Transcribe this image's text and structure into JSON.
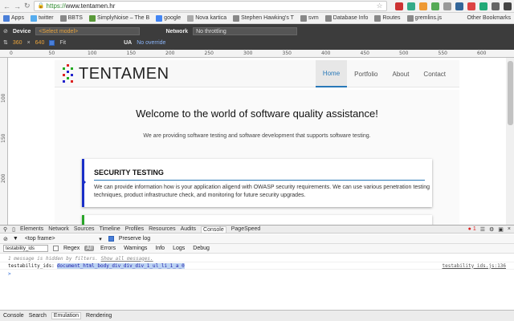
{
  "browser": {
    "url_scheme": "https://",
    "url_host": "www.tentamen.hr",
    "bookmarks": [
      {
        "label": "Apps",
        "color": "#4a7fd8"
      },
      {
        "label": "twitter",
        "color": "#55acee"
      },
      {
        "label": "BBTS",
        "color": "#888888"
      },
      {
        "label": "SimplyNoise – The B",
        "color": "#5a9a3a"
      },
      {
        "label": "google",
        "color": "#4285f4"
      },
      {
        "label": "Nova kartica",
        "color": "#aaaaaa"
      },
      {
        "label": "Stephen Hawking's T",
        "color": "#888888"
      },
      {
        "label": "svm",
        "color": "#888888"
      },
      {
        "label": "Database Info",
        "color": "#888888"
      },
      {
        "label": "Routes",
        "color": "#888888"
      },
      {
        "label": "gremlins.js",
        "color": "#888888"
      }
    ],
    "other_bookmarks": "Other Bookmarks"
  },
  "emulation": {
    "device_label": "Device",
    "device_value": "<Select model>",
    "network_label": "Network",
    "network_value": "No throttling",
    "width": "360",
    "height": "640",
    "fit_label": "Fit",
    "ua_label": "UA",
    "ua_value": "No override"
  },
  "ruler": {
    "labels": [
      "0",
      "50",
      "100",
      "150",
      "200",
      "250",
      "300",
      "350",
      "400",
      "450",
      "500",
      "550",
      "600"
    ],
    "vlabels": [
      "100",
      "150",
      "200"
    ]
  },
  "site": {
    "brand": "TENTAMEN",
    "menu": [
      "Home",
      "Portfolio",
      "About",
      "Contact"
    ],
    "welcome": "Welcome to the world of software quality assistance!",
    "sub": "We are providing software testing and software development that supports software testing.",
    "card_title": "SECURITY TESTING",
    "card_body": "We can provide information how is your application aligend with OWASP security requirements. We can use various penetration testing techniques, product infrastructure check, and monitoring for future security upgrades."
  },
  "devtools": {
    "tabs": [
      "Elements",
      "Network",
      "Sources",
      "Timeline",
      "Profiles",
      "Resources",
      "Audits",
      "Console",
      "PageSpeed"
    ],
    "active_tab": "Console",
    "error_count": "1",
    "frame": "<top frame>",
    "preserve_log": "Preserve log",
    "filter_value": "testability_ids",
    "regex": "Regex",
    "levels": [
      "All",
      "Errors",
      "Warnings",
      "Info",
      "Logs",
      "Debug"
    ],
    "hidden_msg": "1 message is hidden by filters.",
    "show_all": "Show all messages.",
    "log_prefix": "testability_ids:",
    "log_value": "document_html_body_div_div_div_1_ul_li_1_a_0",
    "log_source": "testability_ids.js:136",
    "prompt": ">",
    "drawer_tabs": [
      "Console",
      "Search",
      "Emulation",
      "Rendering"
    ],
    "drawer_active": "Emulation"
  }
}
